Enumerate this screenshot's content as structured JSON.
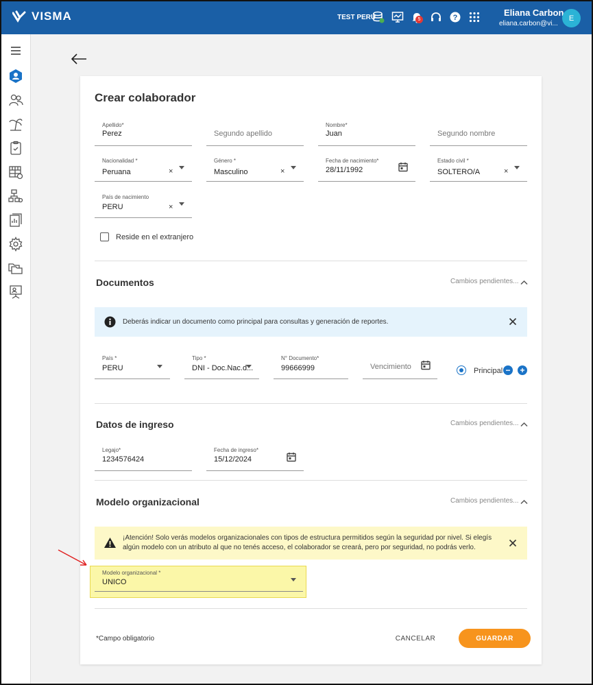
{
  "header": {
    "logo_text": "VISMA",
    "environment": "TEST PERÚ",
    "notification_count": "5",
    "user_name": "Eliana Carbon",
    "user_email": "eliana.carbon@vi...",
    "avatar_initial": "E"
  },
  "colors": {
    "brand": "#1a5fa6",
    "accent": "#f7941d",
    "info_bg": "#e5f3fc",
    "warning_bg": "#fdf8c8",
    "highlight": "#fbf7a8"
  },
  "form": {
    "title": "Crear colaborador",
    "apellido": {
      "label": "Apellido*",
      "value": "Perez"
    },
    "segundo_apellido": {
      "placeholder": "Segundo apellido"
    },
    "nombre": {
      "label": "Nombre*",
      "value": "Juan"
    },
    "segundo_nombre": {
      "placeholder": "Segundo nombre"
    },
    "nacionalidad": {
      "label": "Nacionalidad *",
      "value": "Peruana"
    },
    "genero": {
      "label": "Género *",
      "value": "Masculino"
    },
    "fecha_nacimiento": {
      "label": "Fecha de nacimiento*",
      "value": "28/11/1992"
    },
    "estado_civil": {
      "label": "Estado civil *",
      "value": "SOLTERO/A"
    },
    "pais_nacimiento": {
      "label": "País de nacimiento",
      "value": "PERU"
    },
    "reside_extranjero": {
      "label": "Reside en el extranjero",
      "checked": false
    },
    "clear_symbol": "×"
  },
  "documentos": {
    "title": "Documentos",
    "pending": "Cambios pendientes...",
    "info": "Deberás indicar un documento como principal para consultas y generación de reportes.",
    "pais": {
      "label": "País *",
      "value": "PERU"
    },
    "tipo": {
      "label": "Tipo *",
      "value": "DNI - Doc.Nac.d..."
    },
    "numero": {
      "label": "N° Documento*",
      "value": "99666999"
    },
    "vencimiento": {
      "placeholder": "Vencimiento"
    },
    "principal": "Principal",
    "remove_symbol": "−",
    "add_symbol": "+"
  },
  "ingreso": {
    "title": "Datos de ingreso",
    "pending": "Cambios pendientes...",
    "legajo": {
      "label": "Legajo*",
      "value": "1234576424"
    },
    "fecha_ingreso": {
      "label": "Fecha de ingreso*",
      "value": "15/12/2024"
    }
  },
  "modelo": {
    "title": "Modelo organizacional",
    "pending": "Cambios pendientes...",
    "warning_line1": "¡Atención! Solo verás modelos organizacionales con tipos de estructura permitidos según la seguridad por nivel. Si elegís",
    "warning_line2": "algún modelo con un atributo al que no tenés acceso, el colaborador se creará, pero por seguridad, no podrás verlo.",
    "field": {
      "label": "Modelo organizacional *",
      "value": "UNICO"
    }
  },
  "footer": {
    "required_note": "*Campo obligatorio",
    "cancel": "CANCELAR",
    "save": "GUARDAR"
  }
}
